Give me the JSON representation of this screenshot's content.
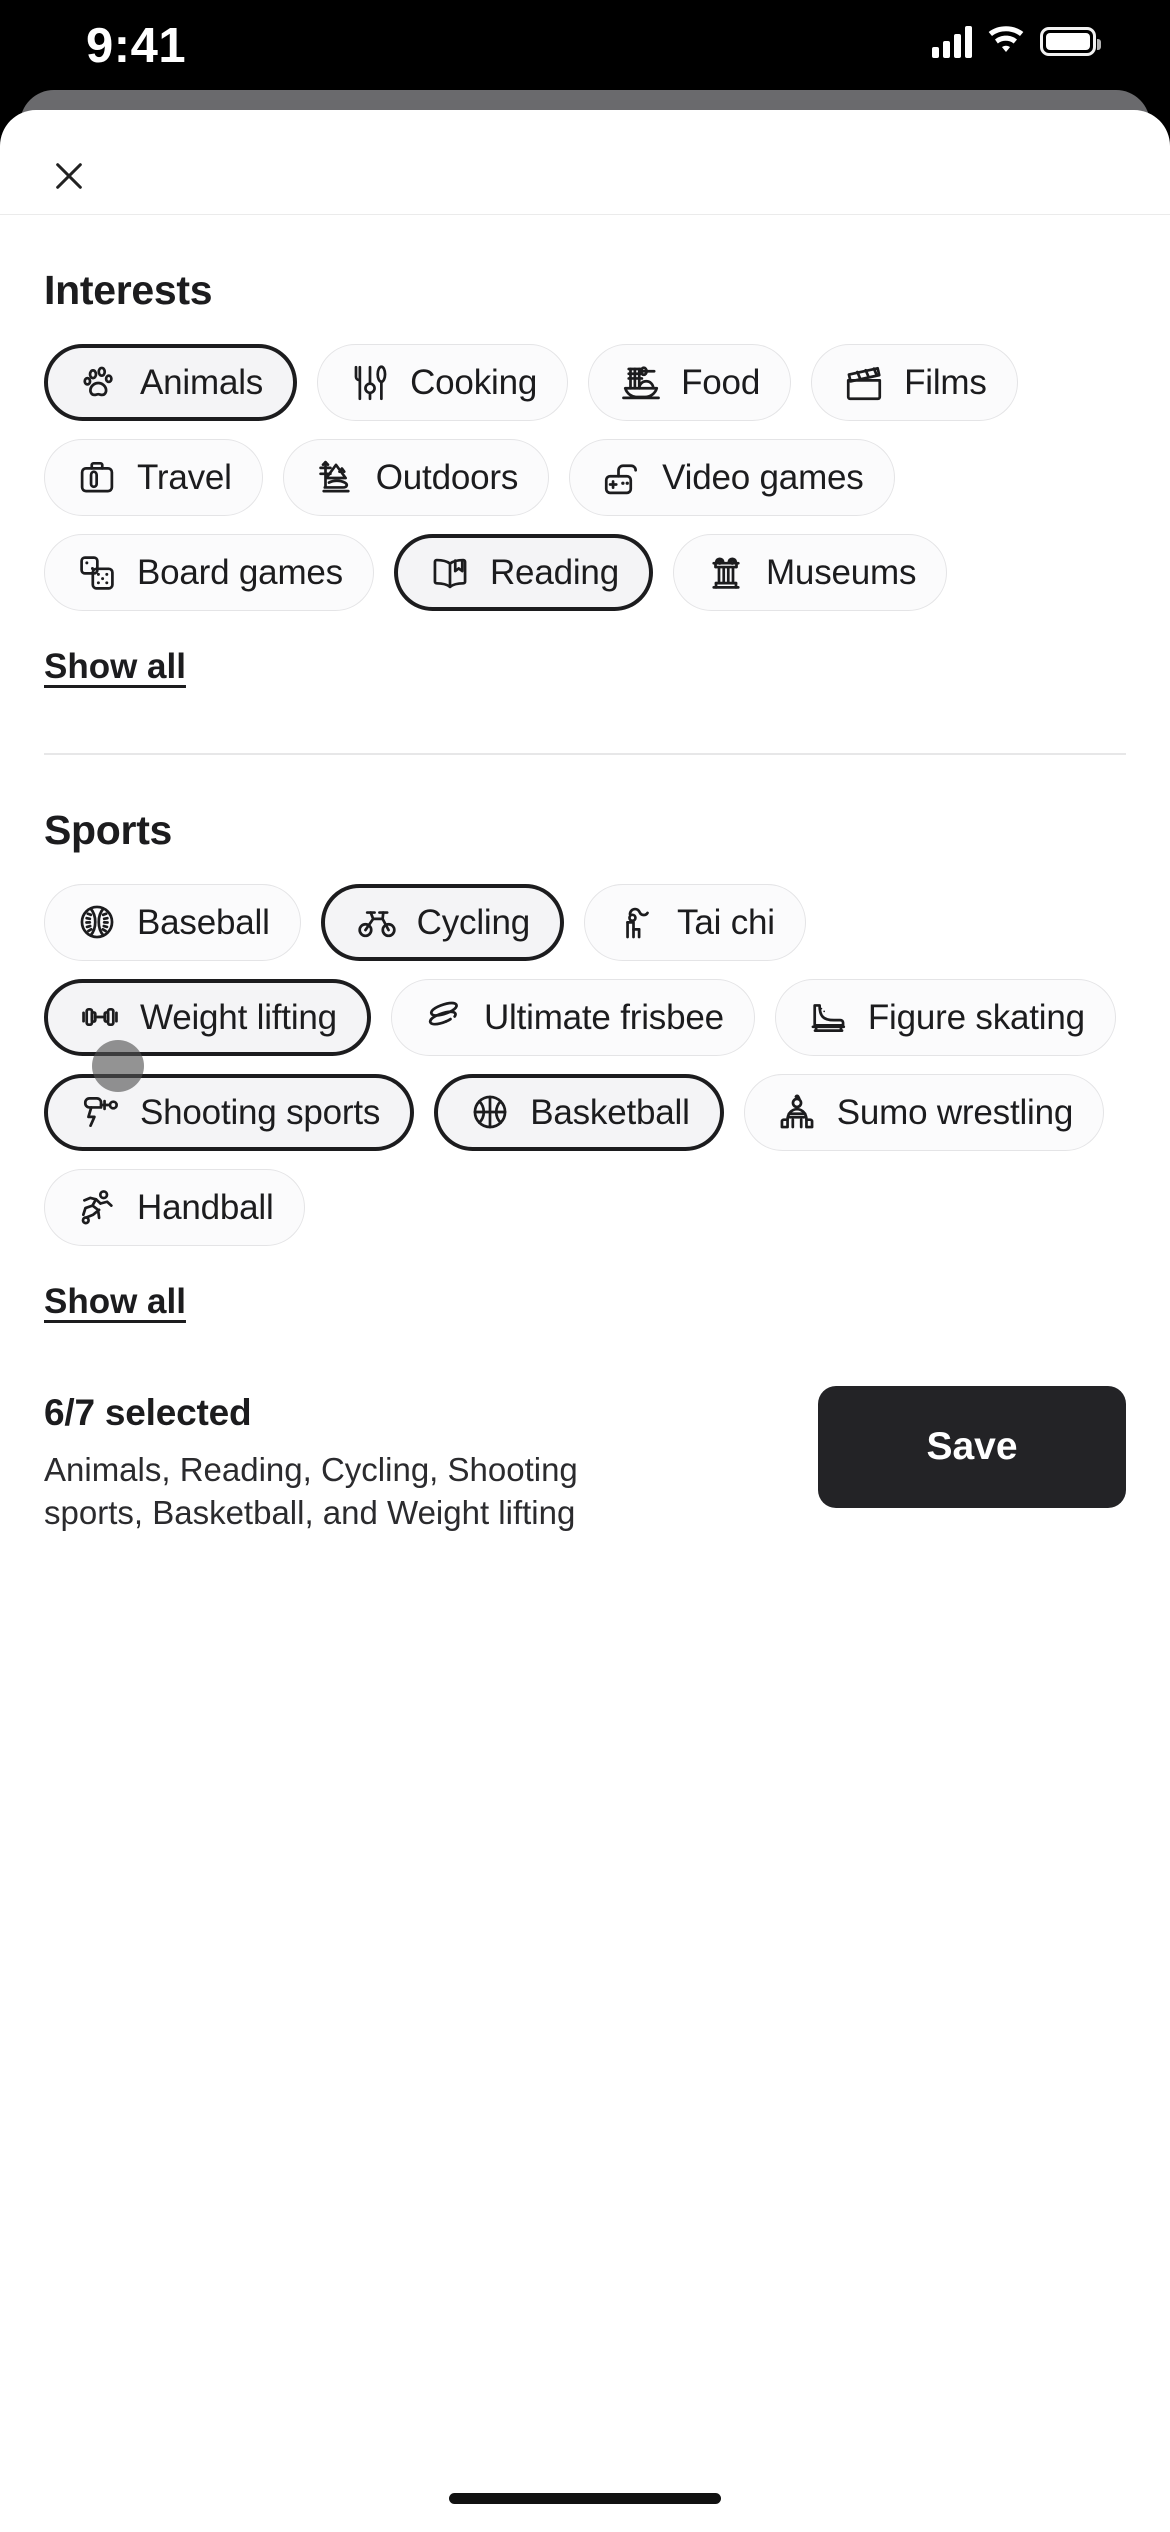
{
  "status_bar": {
    "time": "9:41",
    "cellular_icon": "signal-bars-icon",
    "wifi_icon": "wifi-icon",
    "battery_icon": "battery-icon"
  },
  "header": {
    "close_icon": "close-icon"
  },
  "sections": [
    {
      "id": "interests",
      "title": "Interests",
      "show_all_label": "Show all",
      "chips": [
        {
          "label": "Animals",
          "icon": "paw-print-icon",
          "selected": true
        },
        {
          "label": "Cooking",
          "icon": "utensils-icon",
          "selected": false
        },
        {
          "label": "Food",
          "icon": "noodle-bowl-icon",
          "selected": false
        },
        {
          "label": "Films",
          "icon": "clapperboard-icon",
          "selected": false
        },
        {
          "label": "Travel",
          "icon": "suitcase-icon",
          "selected": false
        },
        {
          "label": "Outdoors",
          "icon": "mountain-tree-icon",
          "selected": false
        },
        {
          "label": "Video games",
          "icon": "gamepad-icon",
          "selected": false
        },
        {
          "label": "Board games",
          "icon": "dice-icon",
          "selected": false
        },
        {
          "label": "Reading",
          "icon": "open-book-icon",
          "selected": true
        },
        {
          "label": "Museums",
          "icon": "greek-column-icon",
          "selected": false
        }
      ]
    },
    {
      "id": "sports",
      "title": "Sports",
      "show_all_label": "Show all",
      "chips": [
        {
          "label": "Baseball",
          "icon": "baseball-icon",
          "selected": false
        },
        {
          "label": "Cycling",
          "icon": "bicycle-icon",
          "selected": true
        },
        {
          "label": "Tai chi",
          "icon": "tai-chi-figure-icon",
          "selected": false
        },
        {
          "label": "Weight lifting",
          "icon": "dumbbell-icon",
          "selected": true
        },
        {
          "label": "Ultimate frisbee",
          "icon": "frisbee-disc-icon",
          "selected": false
        },
        {
          "label": "Figure skating",
          "icon": "ice-skate-icon",
          "selected": false
        },
        {
          "label": "Shooting sports",
          "icon": "shooting-target-icon",
          "selected": true
        },
        {
          "label": "Basketball",
          "icon": "basketball-icon",
          "selected": true
        },
        {
          "label": "Sumo wrestling",
          "icon": "sumo-wrestler-icon",
          "selected": false
        },
        {
          "label": "Handball",
          "icon": "handball-player-icon",
          "selected": false
        }
      ]
    }
  ],
  "footer": {
    "selected_count": "6/7 selected",
    "selected_list": "Animals, Reading, Cycling, Shooting sports, Basketball, and Weight lifting",
    "save_label": "Save"
  },
  "colors": {
    "accent": "#232326",
    "chip_border": "#e4e4e6",
    "chip_selected_border": "#1c1c1e",
    "chip_selected_bg": "#f4f4f6",
    "text": "#1c1c1e"
  }
}
